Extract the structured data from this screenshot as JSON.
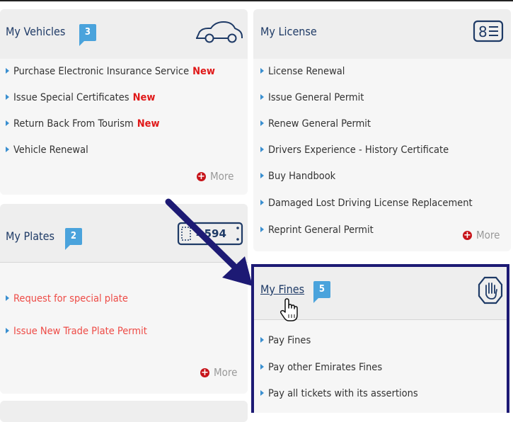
{
  "vehicles": {
    "title": "My Vehicles",
    "count": "3",
    "icon": "car-icon",
    "items": [
      {
        "label": "Purchase Electronic Insurance Service",
        "tag": "New"
      },
      {
        "label": "Issue Special Certificates",
        "tag": "New"
      },
      {
        "label": "Return Back From Tourism",
        "tag": "New"
      },
      {
        "label": "Vehicle Renewal",
        "tag": ""
      }
    ],
    "more": "More"
  },
  "license": {
    "title": "My License",
    "icon": "id-card-icon",
    "items": [
      "License Renewal",
      "Issue General Permit",
      "Renew General Permit",
      "Drivers Experience - History Certificate",
      "Buy Handbook",
      "Damaged Lost Driving License Replacement",
      "Reprint General Permit"
    ],
    "more": "More"
  },
  "plates": {
    "title": "My Plates",
    "count": "2",
    "icon": "license-plate-icon",
    "plate_text": "=594",
    "items": [
      "Request for special plate",
      "Issue New Trade Plate Permit"
    ],
    "more": "More"
  },
  "fines": {
    "title": "My Fines",
    "count": "5",
    "icon": "stop-hand-icon",
    "items": [
      "Pay Fines",
      "Pay other Emirates Fines",
      "Pay all tickets with its assertions"
    ]
  },
  "annotations": {
    "arrow_color": "#1d1a74",
    "highlight_color": "#1d1a74",
    "cursor_icon": "hand-pointer-icon"
  }
}
